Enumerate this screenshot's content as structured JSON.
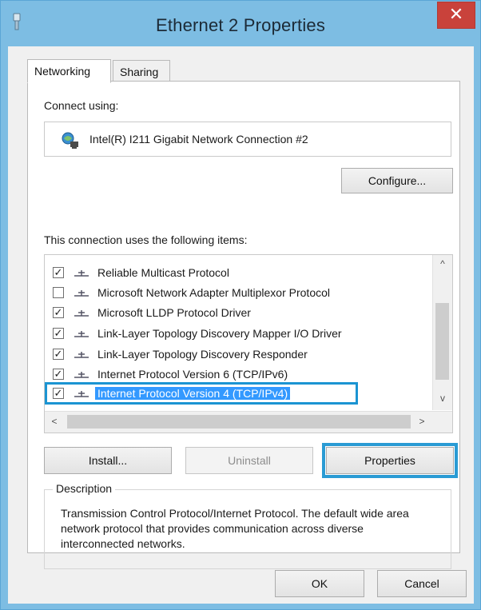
{
  "window": {
    "title": "Ethernet 2 Properties",
    "close_label": "✕"
  },
  "tabs": [
    {
      "label": "Networking",
      "active": true
    },
    {
      "label": "Sharing",
      "active": false
    }
  ],
  "connect_using": {
    "label": "Connect using:",
    "adapter_name": "Intel(R) I211 Gigabit Network Connection #2",
    "adapter_icon": "network-adapter-icon"
  },
  "buttons": {
    "configure": "Configure...",
    "install": "Install...",
    "uninstall": "Uninstall",
    "properties": "Properties",
    "ok": "OK",
    "cancel": "Cancel"
  },
  "items_label": "This connection uses the following items:",
  "items": [
    {
      "label": "Reliable Multicast Protocol",
      "checked": true,
      "check_glyph": "✓"
    },
    {
      "label": "Microsoft Network Adapter Multiplexor Protocol",
      "checked": false,
      "check_glyph": ""
    },
    {
      "label": "Microsoft LLDP Protocol Driver",
      "checked": true,
      "check_glyph": "✓"
    },
    {
      "label": "Link-Layer Topology Discovery Mapper I/O Driver",
      "checked": true,
      "check_glyph": "✓"
    },
    {
      "label": "Link-Layer Topology Discovery Responder",
      "checked": true,
      "check_glyph": "✓"
    },
    {
      "label": "Internet Protocol Version 6 (TCP/IPv6)",
      "checked": true,
      "check_glyph": "✓"
    },
    {
      "label": "Internet Protocol Version 4 (TCP/IPv4)",
      "checked": true,
      "check_glyph": "✓",
      "selected": true
    }
  ],
  "scroll_arrows": {
    "up": "^",
    "down": "v",
    "left": "<",
    "right": ">"
  },
  "description": {
    "legend": "Description",
    "text": "Transmission Control Protocol/Internet Protocol. The default wide area network protocol that provides communication across diverse interconnected networks."
  },
  "colors": {
    "frame": "#7dbde3",
    "close": "#c9423b",
    "selection": "#3399ff",
    "highlight_outline": "#1b94d2"
  }
}
